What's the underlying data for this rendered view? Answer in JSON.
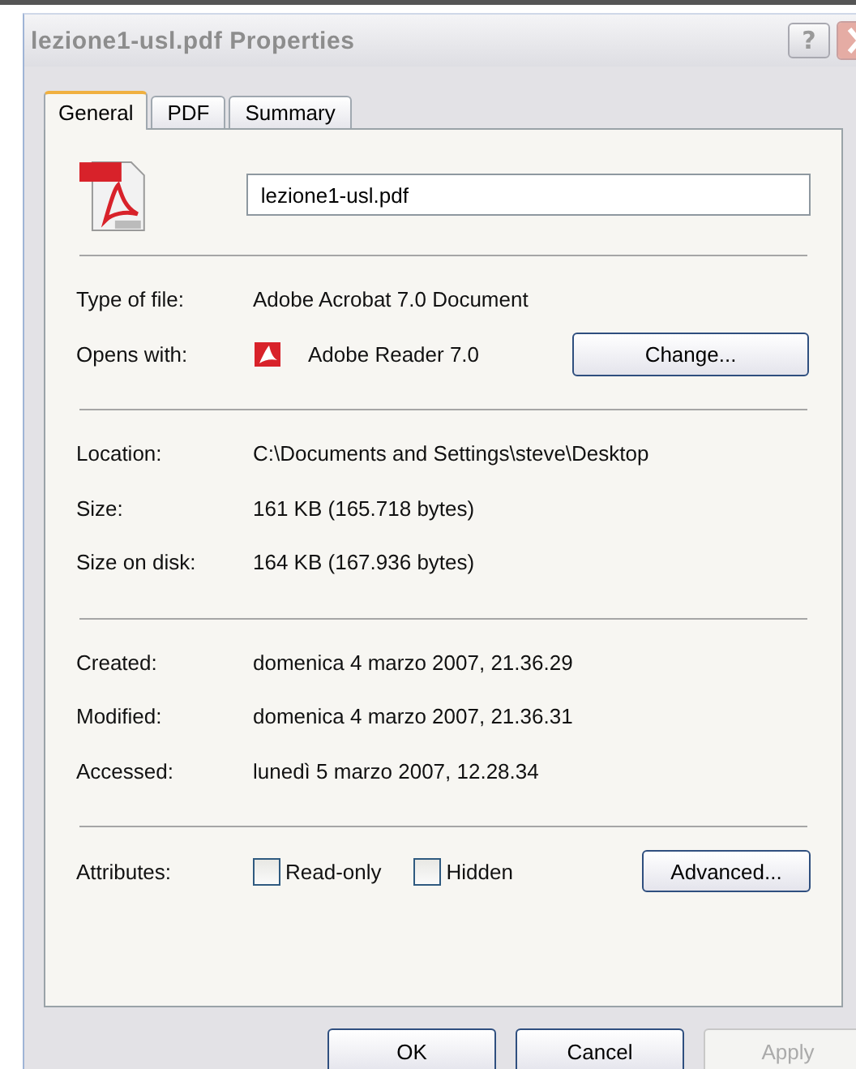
{
  "window": {
    "title": "lezione1-usl.pdf Properties",
    "help": "?"
  },
  "tabs": [
    {
      "label": "General",
      "selected": true
    },
    {
      "label": "PDF",
      "selected": false
    },
    {
      "label": "Summary",
      "selected": false
    }
  ],
  "file_name": {
    "value": "lezione1-usl.pdf"
  },
  "sections": [
    {
      "rows": [
        {
          "kind": "text",
          "label": "Type of file:",
          "value": "Adobe Acrobat 7.0 Document"
        },
        {
          "kind": "app",
          "label": "Opens with:",
          "value": "Adobe Reader 7.0",
          "button": "Change..."
        }
      ]
    },
    {
      "rows": [
        {
          "kind": "text",
          "label": "Location:",
          "value": "C:\\Documents and Settings\\steve\\Desktop"
        },
        {
          "kind": "text",
          "label": "Size:",
          "value": "161 KB (165.718 bytes)"
        },
        {
          "kind": "text",
          "label": "Size on disk:",
          "value": "164 KB (167.936 bytes)"
        }
      ]
    },
    {
      "rows": [
        {
          "kind": "text",
          "label": "Created:",
          "value": "domenica 4 marzo 2007, 21.36.29"
        },
        {
          "kind": "text",
          "label": "Modified:",
          "value": "domenica 4 marzo 2007, 21.36.31"
        },
        {
          "kind": "text",
          "label": "Accessed:",
          "value": "lunedì 5 marzo 2007, 12.28.34"
        }
      ]
    }
  ],
  "attributes": {
    "label": "Attributes:",
    "checkboxes": [
      {
        "label": "Read-only",
        "checked": false
      },
      {
        "label": "Hidden",
        "checked": false
      }
    ],
    "button": "Advanced..."
  },
  "buttons": [
    {
      "label": "OK",
      "disabled": false
    },
    {
      "label": "Cancel",
      "disabled": false
    },
    {
      "label": "Apply",
      "disabled": true
    }
  ]
}
